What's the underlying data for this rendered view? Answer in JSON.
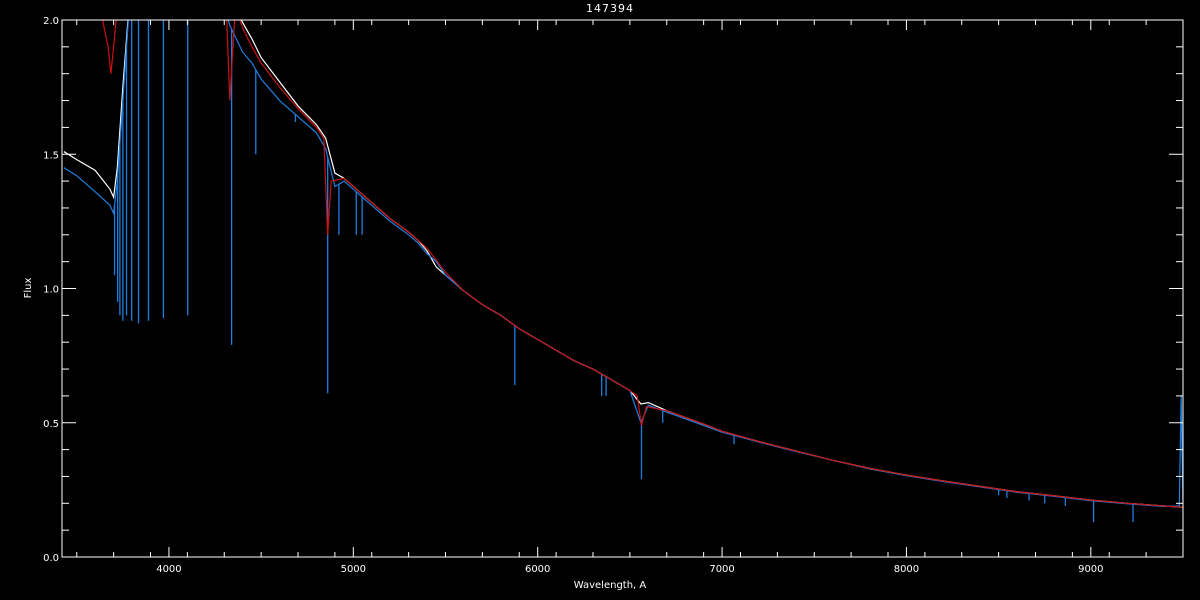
{
  "chart_data": {
    "type": "line",
    "title": "147394",
    "xlabel": "Wavelength, A",
    "ylabel": "Flux",
    "xlim": [
      3420,
      9500
    ],
    "ylim": [
      0.0,
      2.0
    ],
    "x_ticks": [
      4000,
      5000,
      6000,
      7000,
      8000,
      9000
    ],
    "y_ticks": [
      0.0,
      0.5,
      1.0,
      1.5,
      2.0
    ],
    "x_tick_labels": [
      "4000",
      "5000",
      "6000",
      "7000",
      "8000",
      "9000"
    ],
    "y_tick_labels": [
      "0.0",
      "0.5",
      "1.0",
      "1.5",
      "2.0"
    ],
    "grid": false,
    "background": "#000000",
    "axis_color": "#ffffff",
    "series": [
      {
        "color": "#ffffff",
        "points": [
          [
            3430,
            1.51
          ],
          [
            3500,
            1.48
          ],
          [
            3600,
            1.44
          ],
          [
            3680,
            1.37
          ],
          [
            3700,
            1.34
          ],
          [
            3720,
            1.45
          ],
          [
            3750,
            1.75
          ],
          [
            3800,
            2.2
          ],
          [
            4200,
            2.3
          ],
          [
            4330,
            2.1
          ],
          [
            4400,
            1.99
          ],
          [
            4450,
            1.93
          ],
          [
            4500,
            1.86
          ],
          [
            4600,
            1.77
          ],
          [
            4700,
            1.68
          ],
          [
            4800,
            1.61
          ],
          [
            4850,
            1.56
          ],
          [
            4900,
            1.43
          ],
          [
            4950,
            1.41
          ],
          [
            5000,
            1.38
          ],
          [
            5100,
            1.32
          ],
          [
            5200,
            1.26
          ],
          [
            5300,
            1.21
          ],
          [
            5350,
            1.18
          ],
          [
            5400,
            1.14
          ],
          [
            5450,
            1.08
          ],
          [
            5500,
            1.05
          ],
          [
            5600,
            0.99
          ],
          [
            5700,
            0.94
          ],
          [
            5800,
            0.9
          ],
          [
            5900,
            0.85
          ],
          [
            6000,
            0.81
          ],
          [
            6100,
            0.77
          ],
          [
            6200,
            0.73
          ],
          [
            6300,
            0.7
          ],
          [
            6400,
            0.66
          ],
          [
            6500,
            0.62
          ],
          [
            6560,
            0.57
          ],
          [
            6600,
            0.575
          ],
          [
            6700,
            0.545
          ],
          [
            6800,
            0.52
          ],
          [
            6900,
            0.495
          ],
          [
            7000,
            0.468
          ],
          [
            7200,
            0.43
          ],
          [
            7400,
            0.395
          ],
          [
            7600,
            0.36
          ],
          [
            7800,
            0.33
          ],
          [
            8000,
            0.305
          ],
          [
            8200,
            0.283
          ],
          [
            8400,
            0.263
          ],
          [
            8600,
            0.243
          ],
          [
            8800,
            0.228
          ],
          [
            9000,
            0.212
          ],
          [
            9200,
            0.2
          ],
          [
            9400,
            0.19
          ],
          [
            9500,
            0.185
          ]
        ]
      },
      {
        "color": "#1e7fe0",
        "points": [
          [
            3430,
            1.45
          ],
          [
            3500,
            1.42
          ],
          [
            3600,
            1.36
          ],
          [
            3680,
            1.31
          ],
          [
            3700,
            1.28
          ],
          [
            3720,
            1.4
          ],
          [
            3750,
            1.7
          ],
          [
            3800,
            2.2
          ],
          [
            4200,
            2.3
          ],
          [
            4330,
            1.98
          ],
          [
            4400,
            1.88
          ],
          [
            4450,
            1.84
          ],
          [
            4500,
            1.78
          ],
          [
            4600,
            1.7
          ],
          [
            4700,
            1.64
          ],
          [
            4800,
            1.58
          ],
          [
            4850,
            1.52
          ],
          [
            4900,
            1.38
          ],
          [
            4950,
            1.4
          ],
          [
            5000,
            1.37
          ],
          [
            5100,
            1.31
          ],
          [
            5200,
            1.25
          ],
          [
            5300,
            1.2
          ],
          [
            5350,
            1.17
          ],
          [
            5400,
            1.13
          ],
          [
            5450,
            1.1
          ],
          [
            5500,
            1.05
          ],
          [
            5600,
            0.99
          ],
          [
            5700,
            0.94
          ],
          [
            5800,
            0.9
          ],
          [
            5900,
            0.85
          ],
          [
            6000,
            0.81
          ],
          [
            6100,
            0.77
          ],
          [
            6200,
            0.73
          ],
          [
            6300,
            0.7
          ],
          [
            6400,
            0.66
          ],
          [
            6500,
            0.62
          ],
          [
            6560,
            0.5
          ],
          [
            6600,
            0.565
          ],
          [
            6700,
            0.54
          ],
          [
            6800,
            0.515
          ],
          [
            6900,
            0.49
          ],
          [
            7000,
            0.465
          ],
          [
            7200,
            0.428
          ],
          [
            7400,
            0.393
          ],
          [
            7600,
            0.36
          ],
          [
            7800,
            0.328
          ],
          [
            8000,
            0.303
          ],
          [
            8200,
            0.281
          ],
          [
            8400,
            0.261
          ],
          [
            8600,
            0.241
          ],
          [
            8800,
            0.226
          ],
          [
            9000,
            0.21
          ],
          [
            9200,
            0.198
          ],
          [
            9400,
            0.188
          ],
          [
            9480,
            0.19
          ],
          [
            9490,
            0.6
          ],
          [
            9500,
            0.2
          ]
        ],
        "absorption_lines": [
          [
            3705,
            1.05
          ],
          [
            3722,
            0.95
          ],
          [
            3734,
            0.9
          ],
          [
            3750,
            0.88
          ],
          [
            3770,
            0.9
          ],
          [
            3798,
            0.88
          ],
          [
            3835,
            0.87
          ],
          [
            3889,
            0.88
          ],
          [
            3970,
            0.89
          ],
          [
            4102,
            0.9
          ],
          [
            4340,
            0.79
          ],
          [
            4471,
            1.5
          ],
          [
            4686,
            1.62
          ],
          [
            4861,
            0.61
          ],
          [
            4922,
            1.2
          ],
          [
            5016,
            1.2
          ],
          [
            5048,
            1.2
          ],
          [
            5876,
            0.64
          ],
          [
            6347,
            0.6
          ],
          [
            6371,
            0.6
          ],
          [
            6563,
            0.29
          ],
          [
            6678,
            0.5
          ],
          [
            7065,
            0.42
          ],
          [
            8500,
            0.23
          ],
          [
            8545,
            0.22
          ],
          [
            8665,
            0.21
          ],
          [
            8750,
            0.2
          ],
          [
            8862,
            0.19
          ],
          [
            9015,
            0.13
          ],
          [
            9229,
            0.13
          ]
        ],
        "baseline_points": [
          [
            3430,
            0.0
          ],
          [
            9500,
            0.0
          ]
        ]
      },
      {
        "color": "#cc1111",
        "points": [
          [
            3600,
            2.2
          ],
          [
            3640,
            2.0
          ],
          [
            3670,
            1.9
          ],
          [
            3685,
            1.8
          ],
          [
            3700,
            1.9
          ],
          [
            3720,
            2.05
          ],
          [
            3760,
            2.3
          ],
          [
            4300,
            2.25
          ],
          [
            4330,
            1.7
          ],
          [
            4360,
            2.05
          ],
          [
            4400,
            1.97
          ],
          [
            4450,
            1.9
          ],
          [
            4500,
            1.84
          ],
          [
            4600,
            1.75
          ],
          [
            4700,
            1.67
          ],
          [
            4800,
            1.6
          ],
          [
            4840,
            1.56
          ],
          [
            4861,
            1.2
          ],
          [
            4880,
            1.4
          ],
          [
            4950,
            1.41
          ],
          [
            5000,
            1.38
          ],
          [
            5100,
            1.32
          ],
          [
            5200,
            1.26
          ],
          [
            5300,
            1.21
          ],
          [
            5400,
            1.15
          ],
          [
            5500,
            1.06
          ],
          [
            5600,
            0.99
          ],
          [
            5700,
            0.94
          ],
          [
            5800,
            0.9
          ],
          [
            5900,
            0.85
          ],
          [
            6000,
            0.81
          ],
          [
            6100,
            0.77
          ],
          [
            6200,
            0.73
          ],
          [
            6300,
            0.7
          ],
          [
            6400,
            0.66
          ],
          [
            6500,
            0.62
          ],
          [
            6540,
            0.6
          ],
          [
            6563,
            0.49
          ],
          [
            6590,
            0.56
          ],
          [
            6700,
            0.545
          ],
          [
            6800,
            0.52
          ],
          [
            6900,
            0.495
          ],
          [
            7000,
            0.468
          ],
          [
            7200,
            0.43
          ],
          [
            7400,
            0.395
          ],
          [
            7600,
            0.36
          ],
          [
            7800,
            0.33
          ],
          [
            8000,
            0.305
          ],
          [
            8200,
            0.283
          ],
          [
            8400,
            0.263
          ],
          [
            8600,
            0.243
          ],
          [
            8800,
            0.228
          ],
          [
            9000,
            0.212
          ],
          [
            9200,
            0.2
          ],
          [
            9400,
            0.19
          ],
          [
            9500,
            0.185
          ]
        ]
      }
    ]
  }
}
